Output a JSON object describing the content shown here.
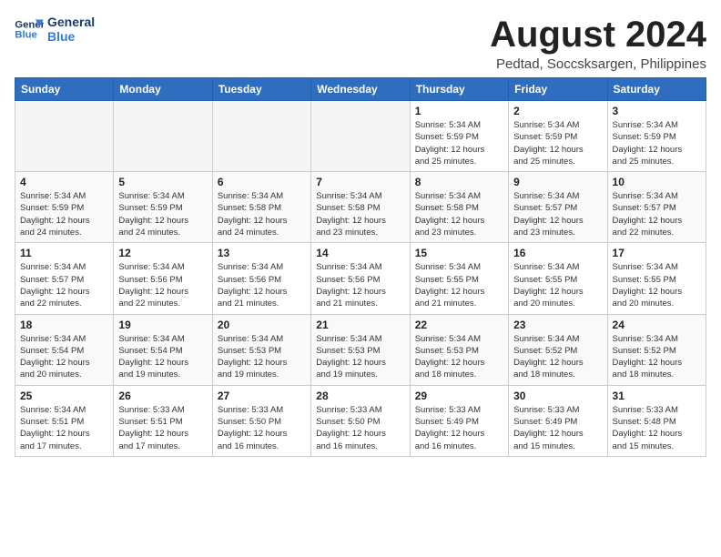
{
  "logo": {
    "line1": "General",
    "line2": "Blue"
  },
  "title": "August 2024",
  "subtitle": "Pedtad, Soccsksargen, Philippines",
  "weekdays": [
    "Sunday",
    "Monday",
    "Tuesday",
    "Wednesday",
    "Thursday",
    "Friday",
    "Saturday"
  ],
  "weeks": [
    [
      {
        "day": "",
        "info": ""
      },
      {
        "day": "",
        "info": ""
      },
      {
        "day": "",
        "info": ""
      },
      {
        "day": "",
        "info": ""
      },
      {
        "day": "1",
        "info": "Sunrise: 5:34 AM\nSunset: 5:59 PM\nDaylight: 12 hours\nand 25 minutes."
      },
      {
        "day": "2",
        "info": "Sunrise: 5:34 AM\nSunset: 5:59 PM\nDaylight: 12 hours\nand 25 minutes."
      },
      {
        "day": "3",
        "info": "Sunrise: 5:34 AM\nSunset: 5:59 PM\nDaylight: 12 hours\nand 25 minutes."
      }
    ],
    [
      {
        "day": "4",
        "info": "Sunrise: 5:34 AM\nSunset: 5:59 PM\nDaylight: 12 hours\nand 24 minutes."
      },
      {
        "day": "5",
        "info": "Sunrise: 5:34 AM\nSunset: 5:59 PM\nDaylight: 12 hours\nand 24 minutes."
      },
      {
        "day": "6",
        "info": "Sunrise: 5:34 AM\nSunset: 5:58 PM\nDaylight: 12 hours\nand 24 minutes."
      },
      {
        "day": "7",
        "info": "Sunrise: 5:34 AM\nSunset: 5:58 PM\nDaylight: 12 hours\nand 23 minutes."
      },
      {
        "day": "8",
        "info": "Sunrise: 5:34 AM\nSunset: 5:58 PM\nDaylight: 12 hours\nand 23 minutes."
      },
      {
        "day": "9",
        "info": "Sunrise: 5:34 AM\nSunset: 5:57 PM\nDaylight: 12 hours\nand 23 minutes."
      },
      {
        "day": "10",
        "info": "Sunrise: 5:34 AM\nSunset: 5:57 PM\nDaylight: 12 hours\nand 22 minutes."
      }
    ],
    [
      {
        "day": "11",
        "info": "Sunrise: 5:34 AM\nSunset: 5:57 PM\nDaylight: 12 hours\nand 22 minutes."
      },
      {
        "day": "12",
        "info": "Sunrise: 5:34 AM\nSunset: 5:56 PM\nDaylight: 12 hours\nand 22 minutes."
      },
      {
        "day": "13",
        "info": "Sunrise: 5:34 AM\nSunset: 5:56 PM\nDaylight: 12 hours\nand 21 minutes."
      },
      {
        "day": "14",
        "info": "Sunrise: 5:34 AM\nSunset: 5:56 PM\nDaylight: 12 hours\nand 21 minutes."
      },
      {
        "day": "15",
        "info": "Sunrise: 5:34 AM\nSunset: 5:55 PM\nDaylight: 12 hours\nand 21 minutes."
      },
      {
        "day": "16",
        "info": "Sunrise: 5:34 AM\nSunset: 5:55 PM\nDaylight: 12 hours\nand 20 minutes."
      },
      {
        "day": "17",
        "info": "Sunrise: 5:34 AM\nSunset: 5:55 PM\nDaylight: 12 hours\nand 20 minutes."
      }
    ],
    [
      {
        "day": "18",
        "info": "Sunrise: 5:34 AM\nSunset: 5:54 PM\nDaylight: 12 hours\nand 20 minutes."
      },
      {
        "day": "19",
        "info": "Sunrise: 5:34 AM\nSunset: 5:54 PM\nDaylight: 12 hours\nand 19 minutes."
      },
      {
        "day": "20",
        "info": "Sunrise: 5:34 AM\nSunset: 5:53 PM\nDaylight: 12 hours\nand 19 minutes."
      },
      {
        "day": "21",
        "info": "Sunrise: 5:34 AM\nSunset: 5:53 PM\nDaylight: 12 hours\nand 19 minutes."
      },
      {
        "day": "22",
        "info": "Sunrise: 5:34 AM\nSunset: 5:53 PM\nDaylight: 12 hours\nand 18 minutes."
      },
      {
        "day": "23",
        "info": "Sunrise: 5:34 AM\nSunset: 5:52 PM\nDaylight: 12 hours\nand 18 minutes."
      },
      {
        "day": "24",
        "info": "Sunrise: 5:34 AM\nSunset: 5:52 PM\nDaylight: 12 hours\nand 18 minutes."
      }
    ],
    [
      {
        "day": "25",
        "info": "Sunrise: 5:34 AM\nSunset: 5:51 PM\nDaylight: 12 hours\nand 17 minutes."
      },
      {
        "day": "26",
        "info": "Sunrise: 5:33 AM\nSunset: 5:51 PM\nDaylight: 12 hours\nand 17 minutes."
      },
      {
        "day": "27",
        "info": "Sunrise: 5:33 AM\nSunset: 5:50 PM\nDaylight: 12 hours\nand 16 minutes."
      },
      {
        "day": "28",
        "info": "Sunrise: 5:33 AM\nSunset: 5:50 PM\nDaylight: 12 hours\nand 16 minutes."
      },
      {
        "day": "29",
        "info": "Sunrise: 5:33 AM\nSunset: 5:49 PM\nDaylight: 12 hours\nand 16 minutes."
      },
      {
        "day": "30",
        "info": "Sunrise: 5:33 AM\nSunset: 5:49 PM\nDaylight: 12 hours\nand 15 minutes."
      },
      {
        "day": "31",
        "info": "Sunrise: 5:33 AM\nSunset: 5:48 PM\nDaylight: 12 hours\nand 15 minutes."
      }
    ]
  ]
}
